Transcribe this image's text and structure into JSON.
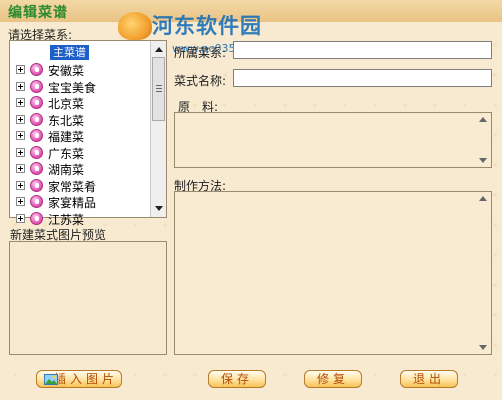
{
  "window": {
    "title": "编辑菜谱",
    "watermark": {
      "title": "河东软件园",
      "url": "www.pc0359.cn"
    }
  },
  "tree": {
    "label": "请选择菜系:",
    "root": "主菜谱",
    "items": [
      "安徽菜",
      "宝宝美食",
      "北京菜",
      "东北菜",
      "福建菜",
      "广东菜",
      "湖南菜",
      "家常菜肴",
      "家宴精品",
      "江苏菜"
    ]
  },
  "preview": {
    "label": "新建菜式图片预览"
  },
  "form": {
    "category_label": "所属菜系:",
    "category_value": "",
    "dish_name_label": "菜式名称:",
    "dish_name_value": "",
    "ingredients_label": "原　料:",
    "ingredients_value": "",
    "method_label": "制作方法:",
    "method_value": ""
  },
  "buttons": {
    "insert_image": "插入图片",
    "save": "保存",
    "modify": "修复",
    "exit": "退出"
  },
  "colors": {
    "window_bg": "#f7ead0",
    "title_text": "#2d8a2d",
    "selection": "#1c5fc8",
    "button_text": "#b54a00",
    "watermark": "#1b6fb8"
  },
  "icons": {
    "tree_item": "cuisine-heart-icon",
    "expand": "plus-box-icon",
    "insert_image": "picture-icon"
  }
}
